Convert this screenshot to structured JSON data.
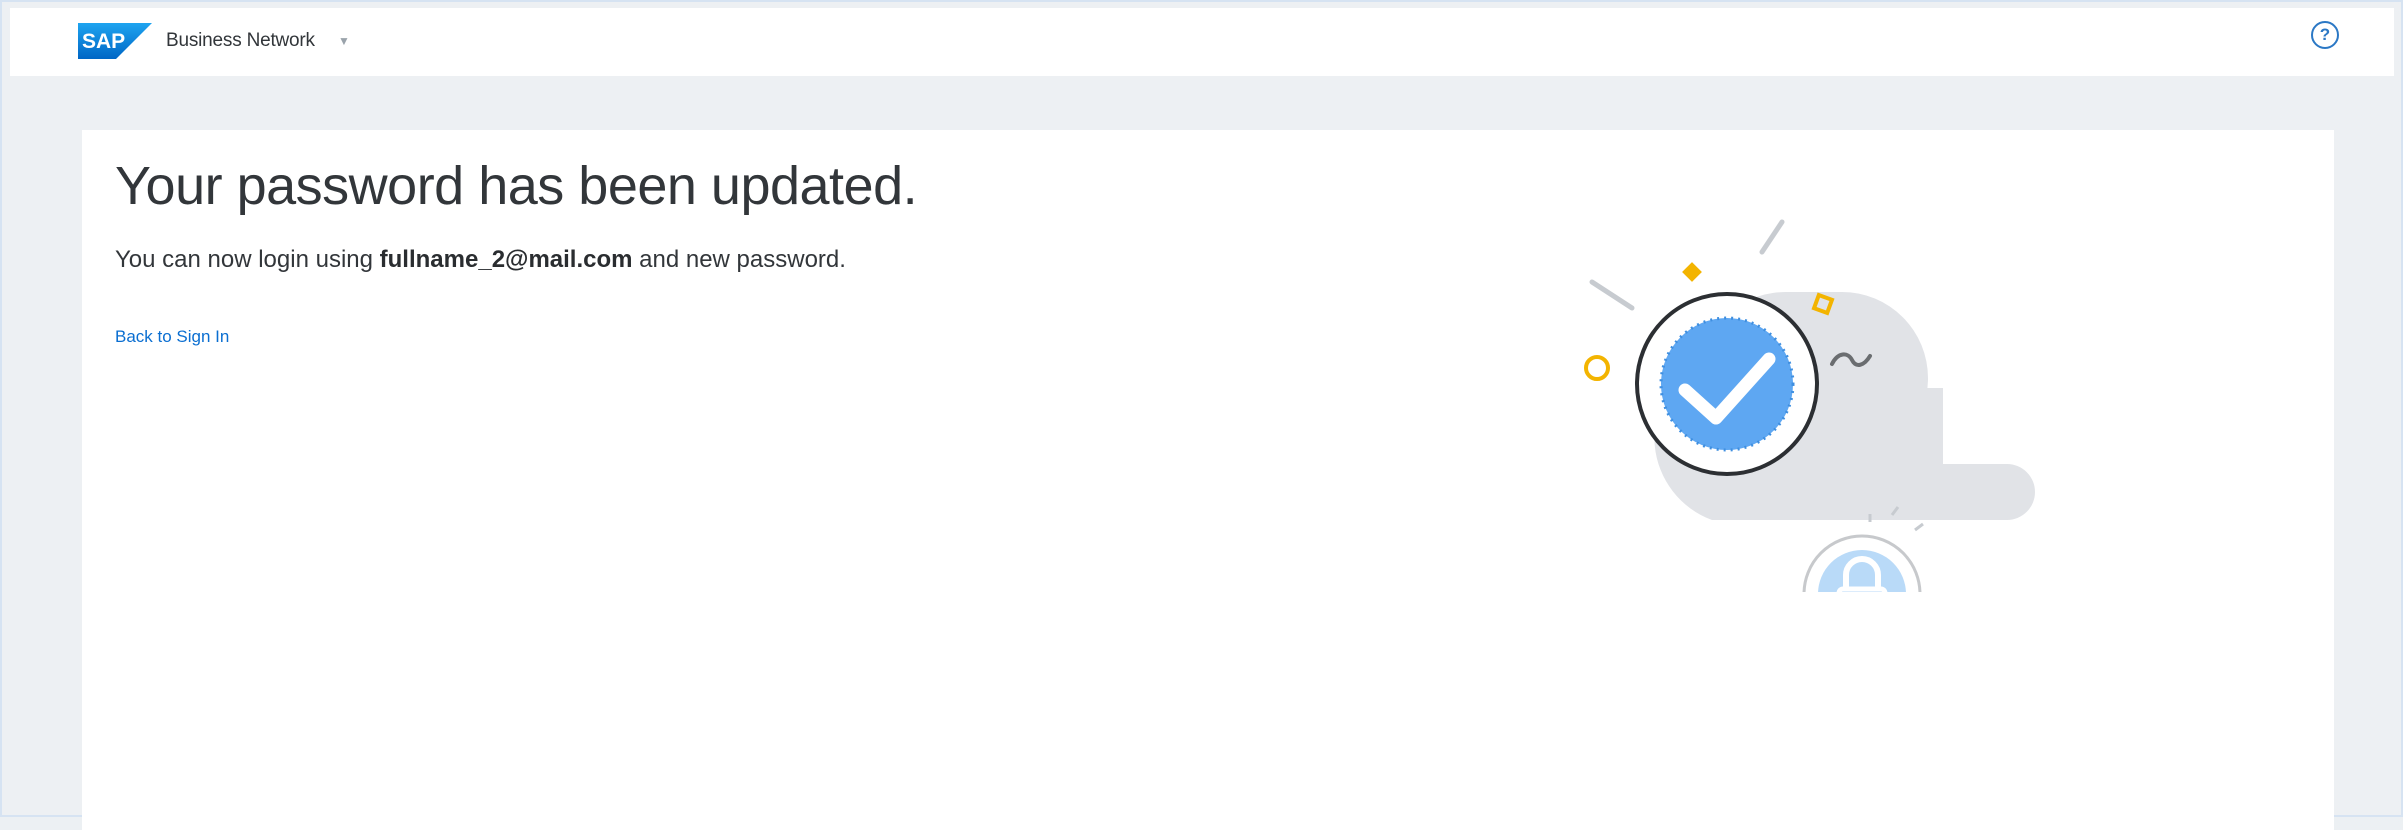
{
  "shellbar": {
    "logo_text": "SAP",
    "product_name": "Business Network",
    "caret": "▼",
    "help_icon": "?"
  },
  "main": {
    "title": "Your password has been updated.",
    "message_prefix": "You can now login using ",
    "message_email": "fullname_2@mail.com",
    "message_suffix": " and new password.",
    "back_link": "Back to Sign In"
  },
  "illustration": {
    "name": "password-success-illustration",
    "colors": {
      "cloud": "#e1e3e7",
      "check_fill": "#5ea7f2",
      "check_ring": "#2c2f33",
      "lock_fill": "#b9daf8",
      "accent_yellow": "#f3b400"
    }
  },
  "colors": {
    "link": "#0a6ed1",
    "text": "#32363a",
    "background": "#edf0f3"
  }
}
